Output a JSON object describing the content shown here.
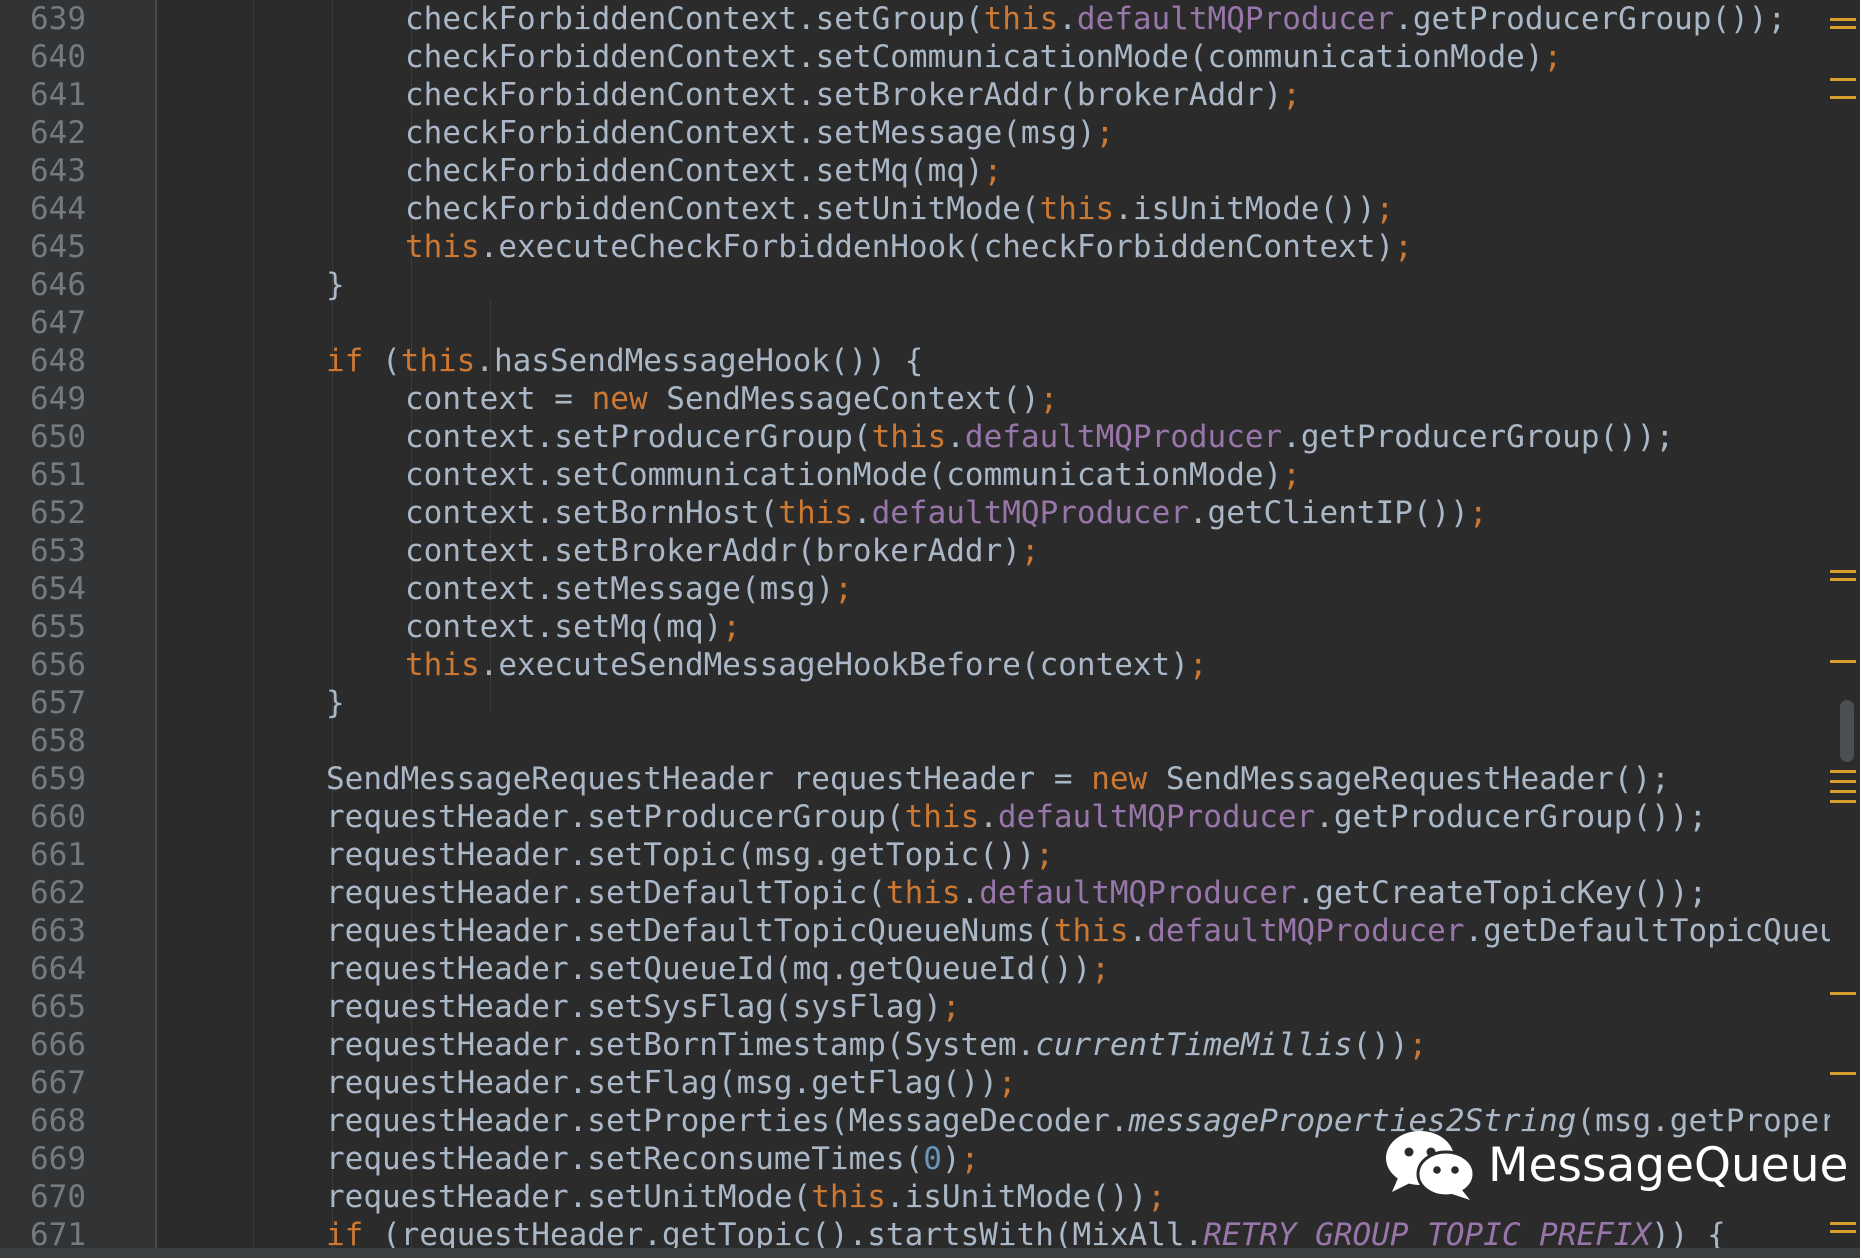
{
  "editor": {
    "lines": [
      {
        "n": "639",
        "indent": 3,
        "tokens": [
          [
            "",
            "checkForbiddenContext.setGroup("
          ],
          [
            "kw",
            "this"
          ],
          [
            "",
            "."
          ],
          [
            "fld",
            "defaultMQProducer"
          ],
          [
            "",
            ".getProducerGroup());"
          ]
        ]
      },
      {
        "n": "640",
        "indent": 3,
        "tokens": [
          [
            "",
            "checkForbiddenContext.setCommunicationMode(communicationMode)"
          ],
          [
            "punc",
            ";"
          ]
        ]
      },
      {
        "n": "641",
        "indent": 3,
        "tokens": [
          [
            "",
            "checkForbiddenContext.setBrokerAddr(brokerAddr)"
          ],
          [
            "punc",
            ";"
          ]
        ]
      },
      {
        "n": "642",
        "indent": 3,
        "tokens": [
          [
            "",
            "checkForbiddenContext.setMessage(msg)"
          ],
          [
            "punc",
            ";"
          ]
        ]
      },
      {
        "n": "643",
        "indent": 3,
        "tokens": [
          [
            "",
            "checkForbiddenContext.setMq(mq)"
          ],
          [
            "punc",
            ";"
          ]
        ]
      },
      {
        "n": "644",
        "indent": 3,
        "tokens": [
          [
            "",
            "checkForbiddenContext.setUnitMode("
          ],
          [
            "kw",
            "this"
          ],
          [
            "",
            ".isUnitMode())"
          ],
          [
            "punc",
            ";"
          ]
        ]
      },
      {
        "n": "645",
        "indent": 3,
        "tokens": [
          [
            "kw",
            "this"
          ],
          [
            "",
            ".executeCheckForbiddenHook(checkForbiddenContext)"
          ],
          [
            "punc",
            ";"
          ]
        ]
      },
      {
        "n": "646",
        "indent": 2,
        "tokens": [
          [
            "",
            "}"
          ]
        ]
      },
      {
        "n": "647",
        "indent": 2,
        "tokens": []
      },
      {
        "n": "648",
        "indent": 2,
        "tokens": [
          [
            "kw",
            "if"
          ],
          [
            "",
            " ("
          ],
          [
            "kw",
            "this"
          ],
          [
            "",
            ".hasSendMessageHook()) {"
          ]
        ]
      },
      {
        "n": "649",
        "indent": 3,
        "tokens": [
          [
            "",
            "context = "
          ],
          [
            "kw",
            "new"
          ],
          [
            "",
            " SendMessageContext()"
          ],
          [
            "punc",
            ";"
          ]
        ]
      },
      {
        "n": "650",
        "indent": 3,
        "tokens": [
          [
            "",
            "context.setProducerGroup("
          ],
          [
            "kw",
            "this"
          ],
          [
            "",
            "."
          ],
          [
            "fld",
            "defaultMQProducer"
          ],
          [
            "",
            ".getProducerGroup());"
          ]
        ]
      },
      {
        "n": "651",
        "indent": 3,
        "tokens": [
          [
            "",
            "context.setCommunicationMode(communicationMode)"
          ],
          [
            "punc",
            ";"
          ]
        ]
      },
      {
        "n": "652",
        "indent": 3,
        "tokens": [
          [
            "",
            "context.setBornHost("
          ],
          [
            "kw",
            "this"
          ],
          [
            "",
            "."
          ],
          [
            "fld",
            "defaultMQProducer"
          ],
          [
            "",
            ".getClientIP())"
          ],
          [
            "punc",
            ";"
          ]
        ]
      },
      {
        "n": "653",
        "indent": 3,
        "tokens": [
          [
            "",
            "context.setBrokerAddr(brokerAddr)"
          ],
          [
            "punc",
            ";"
          ]
        ]
      },
      {
        "n": "654",
        "indent": 3,
        "tokens": [
          [
            "",
            "context.setMessage(msg)"
          ],
          [
            "punc",
            ";"
          ]
        ]
      },
      {
        "n": "655",
        "indent": 3,
        "tokens": [
          [
            "",
            "context.setMq(mq)"
          ],
          [
            "punc",
            ";"
          ]
        ]
      },
      {
        "n": "656",
        "indent": 3,
        "tokens": [
          [
            "kw",
            "this"
          ],
          [
            "",
            ".executeSendMessageHookBefore(context)"
          ],
          [
            "punc",
            ";"
          ]
        ]
      },
      {
        "n": "657",
        "indent": 2,
        "tokens": [
          [
            "",
            "}"
          ]
        ]
      },
      {
        "n": "658",
        "indent": 2,
        "tokens": []
      },
      {
        "n": "659",
        "indent": 2,
        "tokens": [
          [
            "",
            "SendMessageRequestHeader requestHeader = "
          ],
          [
            "kw",
            "new"
          ],
          [
            "",
            " SendMessageRequestHeader();"
          ]
        ]
      },
      {
        "n": "660",
        "indent": 2,
        "tokens": [
          [
            "",
            "requestHeader.setProducerGroup("
          ],
          [
            "kw",
            "this"
          ],
          [
            "",
            "."
          ],
          [
            "fld",
            "defaultMQProducer"
          ],
          [
            "",
            ".getProducerGroup());"
          ]
        ]
      },
      {
        "n": "661",
        "indent": 2,
        "tokens": [
          [
            "",
            "requestHeader.setTopic(msg.getTopic())"
          ],
          [
            "punc",
            ";"
          ]
        ]
      },
      {
        "n": "662",
        "indent": 2,
        "tokens": [
          [
            "",
            "requestHeader.setDefaultTopic("
          ],
          [
            "kw",
            "this"
          ],
          [
            "",
            "."
          ],
          [
            "fld",
            "defaultMQProducer"
          ],
          [
            "",
            ".getCreateTopicKey());"
          ]
        ]
      },
      {
        "n": "663",
        "indent": 2,
        "tokens": [
          [
            "",
            "requestHeader.setDefaultTopicQueueNums("
          ],
          [
            "kw",
            "this"
          ],
          [
            "",
            "."
          ],
          [
            "fld",
            "defaultMQProducer"
          ],
          [
            "",
            ".getDefaultTopicQueueNums());"
          ]
        ]
      },
      {
        "n": "664",
        "indent": 2,
        "tokens": [
          [
            "",
            "requestHeader.setQueueId(mq.getQueueId())"
          ],
          [
            "punc",
            ";"
          ]
        ]
      },
      {
        "n": "665",
        "indent": 2,
        "tokens": [
          [
            "",
            "requestHeader.setSysFlag(sysFlag)"
          ],
          [
            "punc",
            ";"
          ]
        ]
      },
      {
        "n": "666",
        "indent": 2,
        "tokens": [
          [
            "",
            "requestHeader.setBornTimestamp(System."
          ],
          [
            "it",
            "currentTimeMillis"
          ],
          [
            "",
            "())"
          ],
          [
            "punc",
            ";"
          ]
        ]
      },
      {
        "n": "667",
        "indent": 2,
        "tokens": [
          [
            "",
            "requestHeader.setFlag(msg.getFlag())"
          ],
          [
            "punc",
            ";"
          ]
        ]
      },
      {
        "n": "668",
        "indent": 2,
        "tokens": [
          [
            "",
            "requestHeader.setProperties(MessageDecoder."
          ],
          [
            "it",
            "messageProperties2String"
          ],
          [
            "",
            "(msg.getProperties()));"
          ]
        ]
      },
      {
        "n": "669",
        "indent": 2,
        "tokens": [
          [
            "",
            "requestHeader.setReconsumeTimes("
          ],
          [
            "num",
            "0"
          ],
          [
            "",
            ")"
          ],
          [
            "punc",
            ";"
          ]
        ]
      },
      {
        "n": "670",
        "indent": 2,
        "tokens": [
          [
            "",
            "requestHeader.setUnitMode("
          ],
          [
            "kw",
            "this"
          ],
          [
            "",
            ".isUnitMode())"
          ],
          [
            "punc",
            ";"
          ]
        ]
      },
      {
        "n": "671",
        "indent": 2,
        "tokens": [
          [
            "kw",
            "if"
          ],
          [
            "",
            " (requestHeader.getTopic().startsWith(MixAll."
          ],
          [
            "cnst",
            "RETRY_GROUP_TOPIC_PREFIX"
          ],
          [
            "",
            ")) {"
          ]
        ]
      }
    ]
  },
  "watermark": {
    "icon": "wechat-icon",
    "label": "MessageQueue"
  },
  "colors": {
    "background": "#2b2b2b",
    "keyword": "#cc7832",
    "field": "#9876aa",
    "number": "#6897bb",
    "text": "#a9b7c6",
    "line_number": "#747a80"
  }
}
